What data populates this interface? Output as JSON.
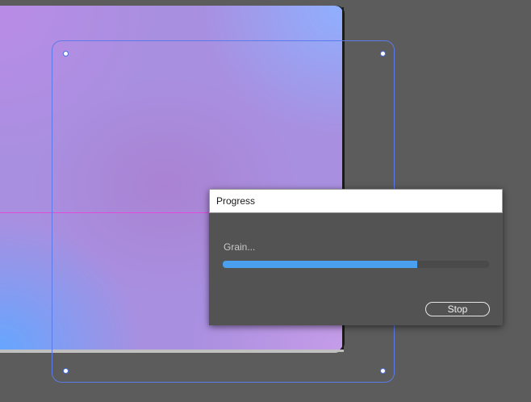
{
  "dialog": {
    "title": "Progress",
    "status_text": "Grain...",
    "progress_fraction": 0.73,
    "stop_label": "Stop"
  },
  "colors": {
    "progress_fill": "#4aa0ee",
    "selection_border": "#5d7be8",
    "guide": "#e04bd8",
    "workspace": "#5c5c5c"
  },
  "icons": {
    "handle": "selection-handle"
  }
}
